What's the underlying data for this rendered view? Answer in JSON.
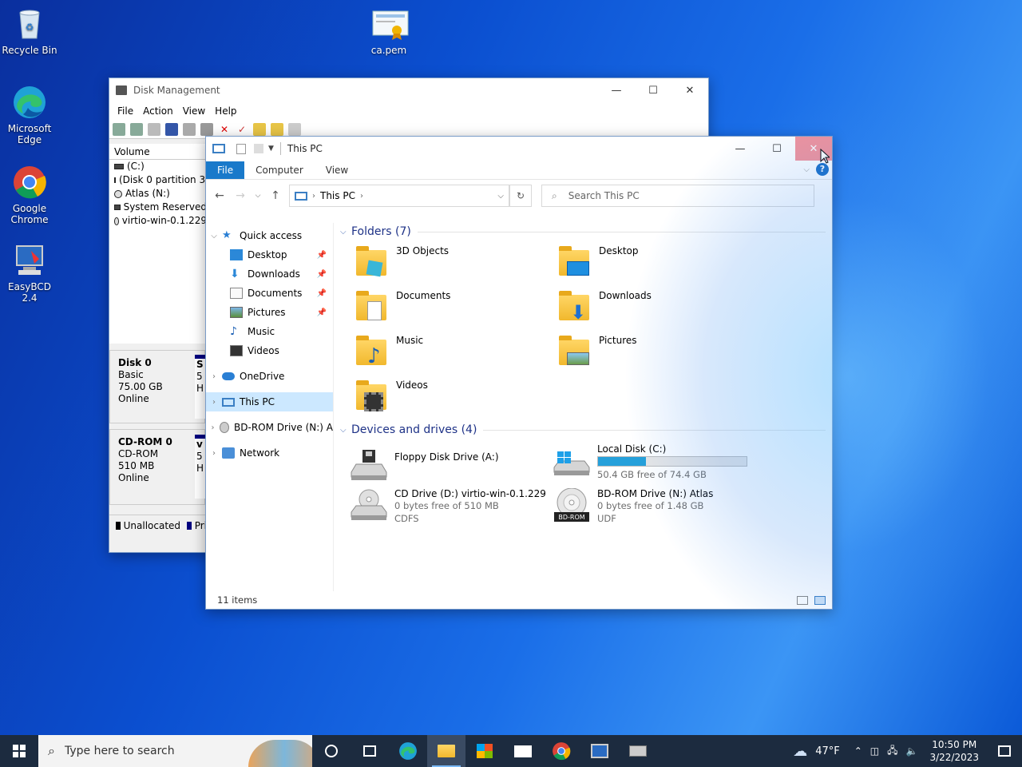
{
  "desktop": {
    "icons": [
      {
        "label": "Recycle Bin",
        "icon": "recycle-bin-icon"
      },
      {
        "label": "ca.pem",
        "icon": "certificate-icon"
      },
      {
        "label": "Microsoft Edge",
        "icon": "edge-icon"
      },
      {
        "label": "Google Chrome",
        "icon": "chrome-icon"
      },
      {
        "label": "EasyBCD 2.4",
        "icon": "easybcd-icon"
      }
    ]
  },
  "disk_mgmt": {
    "title": "Disk Management",
    "menu": [
      "File",
      "Action",
      "View",
      "Help"
    ],
    "volume_header": "Volume",
    "volumes": [
      "(C:)",
      "(Disk 0 partition 3)",
      "Atlas (N:)",
      "System Reserved",
      "virtio-win-0.1.229"
    ],
    "disks": [
      {
        "name": "Disk 0",
        "type": "Basic",
        "size": "75.00 GB",
        "status": "Online",
        "part_initial": "S",
        "part_line2": "5",
        "part_line3": "H"
      },
      {
        "name": "CD-ROM 0",
        "type": "CD-ROM",
        "size": "510 MB",
        "status": "Online",
        "part_initial": "v",
        "part_line2": "5",
        "part_line3": "H"
      }
    ],
    "legend": [
      "Unallocated",
      "Pri"
    ]
  },
  "explorer": {
    "title": "This PC",
    "ribbon_tabs": [
      "File",
      "Computer",
      "View"
    ],
    "address": "This PC",
    "search_placeholder": "Search This PC",
    "nav": {
      "quick_access": "Quick access",
      "quick_items": [
        "Desktop",
        "Downloads",
        "Documents",
        "Pictures",
        "Music",
        "Videos"
      ],
      "onedrive": "OneDrive",
      "this_pc": "This PC",
      "bdrom": "BD-ROM Drive (N:) A",
      "network": "Network"
    },
    "folders_header": "Folders (7)",
    "folders": [
      "3D Objects",
      "Desktop",
      "Documents",
      "Downloads",
      "Music",
      "Pictures",
      "Videos"
    ],
    "devices_header": "Devices and drives (4)",
    "drives": [
      {
        "name": "Floppy Disk Drive (A:)"
      },
      {
        "name": "Local Disk (C:)",
        "free": "50.4 GB free of 74.4 GB",
        "used_fraction": 0.32
      },
      {
        "name": "CD Drive (D:) virtio-win-0.1.229",
        "free": "0 bytes free of 510 MB",
        "fs": "CDFS"
      },
      {
        "name": "BD-ROM Drive (N:) Atlas",
        "free": "0 bytes free of 1.48 GB",
        "fs": "UDF",
        "badge": "BD-ROM"
      }
    ],
    "status": "11 items"
  },
  "taskbar": {
    "search_placeholder": "Type here to search",
    "weather": "47°F",
    "time": "10:50 PM",
    "date": "3/22/2023"
  }
}
